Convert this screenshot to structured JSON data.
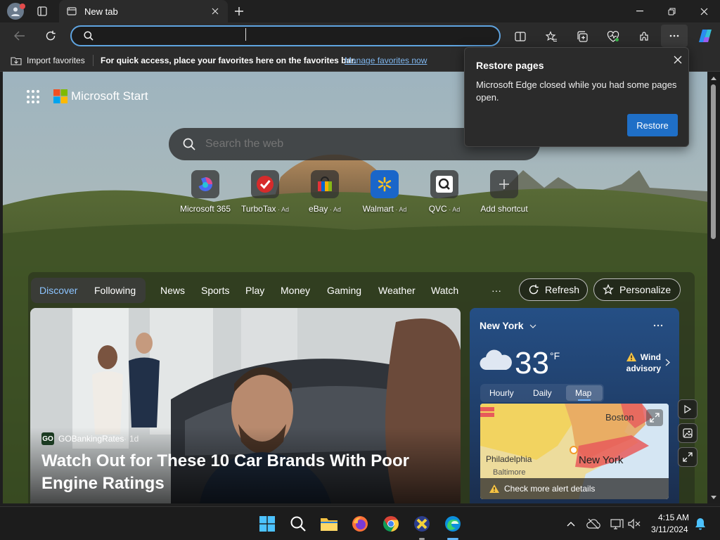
{
  "browser": {
    "tab_title": "New tab",
    "address_value": "",
    "favorites_bar": {
      "import_label": "Import favorites",
      "hint_text": "For quick access, place your favorites here on the favorites bar.",
      "manage_link": "Manage favorites now"
    }
  },
  "popup": {
    "title": "Restore pages",
    "message": "Microsoft Edge closed while you had some pages open.",
    "button": "Restore"
  },
  "page": {
    "brand": "Microsoft Start",
    "search_placeholder": "Search the web",
    "shortcuts": [
      {
        "label": "Microsoft 365",
        "ad": ""
      },
      {
        "label": "TurboTax",
        "ad": "Ad"
      },
      {
        "label": "eBay",
        "ad": "Ad"
      },
      {
        "label": "Walmart",
        "ad": "Ad"
      },
      {
        "label": "QVC",
        "ad": "Ad"
      },
      {
        "label": "Add shortcut",
        "ad": ""
      }
    ],
    "nav": {
      "discover": "Discover",
      "following": "Following",
      "items": [
        "News",
        "Sports",
        "Play",
        "Money",
        "Gaming",
        "Weather",
        "Watch"
      ],
      "more": "···",
      "refresh": "Refresh",
      "personalize": "Personalize"
    },
    "hero": {
      "source": "GOBankingRates",
      "age": "1d",
      "title": "Watch Out for These 10 Car Brands With Poor Engine Ratings"
    },
    "weather": {
      "location": "New York",
      "temp": "33",
      "unit": "°F",
      "alert": "Wind advisory",
      "tabs": [
        "Hourly",
        "Daily",
        "Map"
      ],
      "map_labels": {
        "boston": "Boston",
        "philadelphia": "Philadelphia",
        "baltimore": "Baltimore",
        "newyork": "New York"
      },
      "alert_details": "Check more alert details"
    }
  },
  "taskbar": {
    "time": "4:15 AM",
    "date": "3/11/2024"
  },
  "colors": {
    "accent": "#1f6fc7",
    "address_border": "#5fa4e0",
    "link": "#7fb6ee"
  }
}
